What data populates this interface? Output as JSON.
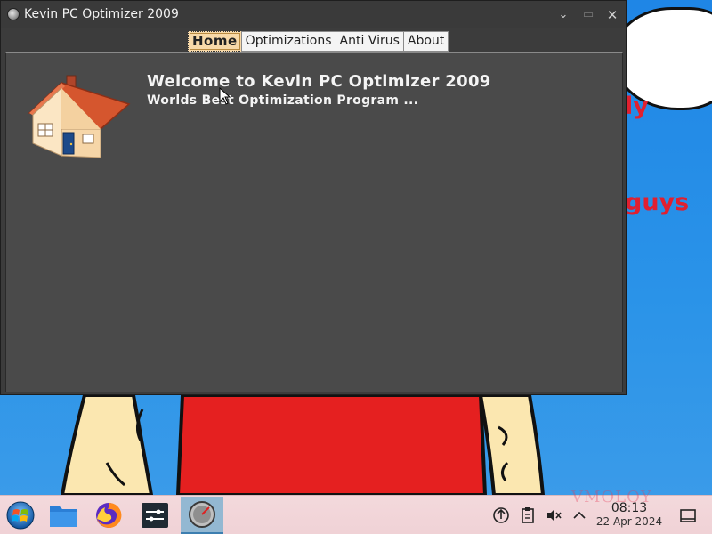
{
  "desktop": {
    "speech_bubble_line1": "ly",
    "speech_bubble_line2": "guys",
    "watermark": "VMOLOY"
  },
  "window": {
    "title": "Kevin PC Optimizer 2009",
    "minimize_symbol": "⌄",
    "maximize_symbol": "▭",
    "close_symbol": "✕",
    "tabs": [
      {
        "label": "Home",
        "active": true
      },
      {
        "label": "Optimizations",
        "active": false
      },
      {
        "label": "Anti Virus",
        "active": false
      },
      {
        "label": "About",
        "active": false
      }
    ],
    "home": {
      "heading": "Welcome to Kevin PC Optimizer 2009",
      "subheading": "Worlds Best Optimization Program ..."
    },
    "icon": "house-icon"
  },
  "taskbar": {
    "items": [
      {
        "name": "start-menu-button",
        "icon": "windows-orb-icon"
      },
      {
        "name": "file-manager-button",
        "icon": "folder-icon"
      },
      {
        "name": "firefox-button",
        "icon": "firefox-icon"
      },
      {
        "name": "settings-button",
        "icon": "sliders-icon"
      },
      {
        "name": "kevin-optimizer-taskbar-button",
        "icon": "app-orb-icon",
        "active": true
      }
    ],
    "tray": [
      "network-icon",
      "clipboard-icon",
      "volume-muted-icon",
      "chevron-up-icon"
    ],
    "clock": {
      "time": "08:13",
      "date": "22 Apr 2024"
    },
    "show_desktop_icon": "show-desktop-icon"
  },
  "colors": {
    "desktop_blue": "#2a93e8",
    "window_bg": "#3c3c3c",
    "panel_bg": "#4a4a4a",
    "active_tab": "#f8d9a8",
    "taskbar_bg": "#f0d2d6"
  }
}
